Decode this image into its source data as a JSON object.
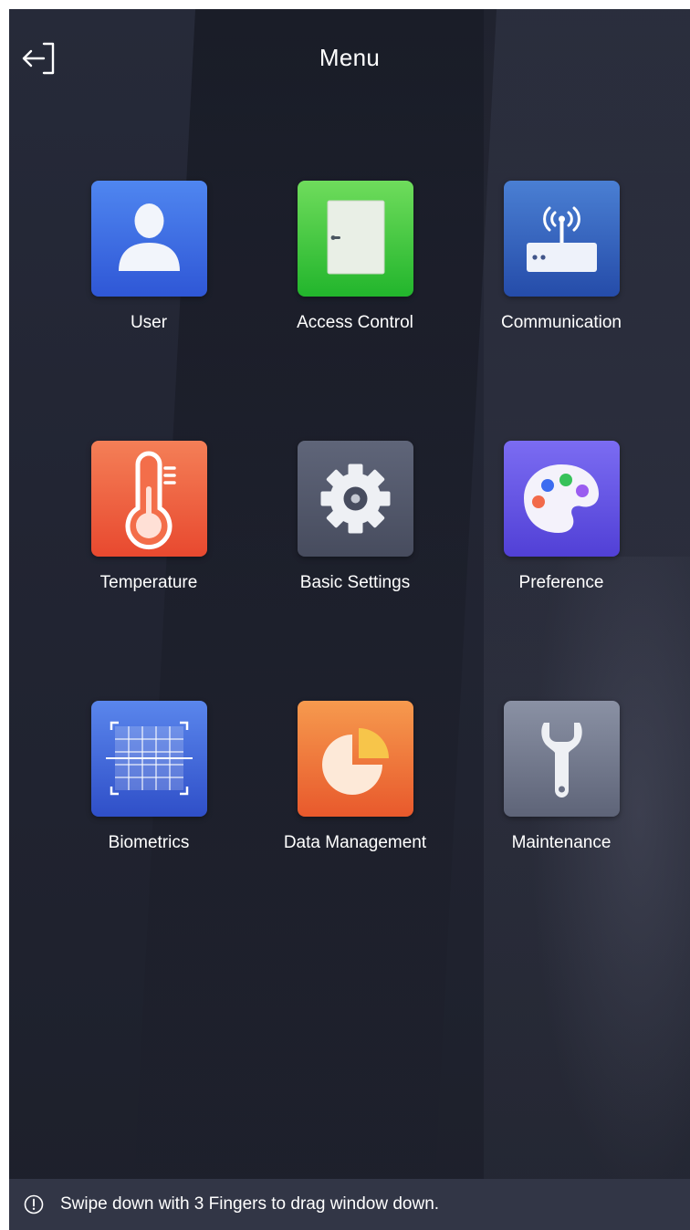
{
  "header": {
    "title": "Menu",
    "back_icon": "exit-icon"
  },
  "menu": {
    "items": [
      {
        "label": "User",
        "icon": "user-icon"
      },
      {
        "label": "Access Control",
        "icon": "door-icon"
      },
      {
        "label": "Communication",
        "icon": "router-icon"
      },
      {
        "label": "Temperature",
        "icon": "thermometer-icon"
      },
      {
        "label": "Basic Settings",
        "icon": "gear-icon"
      },
      {
        "label": "Preference",
        "icon": "palette-icon"
      },
      {
        "label": "Biometrics",
        "icon": "biometric-scan-icon"
      },
      {
        "label": "Data Management",
        "icon": "pie-chart-icon"
      },
      {
        "label": "Maintenance",
        "icon": "wrench-icon"
      }
    ]
  },
  "tip": {
    "text": "Swipe down with 3 Fingers to drag window down.",
    "icon": "info-icon"
  }
}
